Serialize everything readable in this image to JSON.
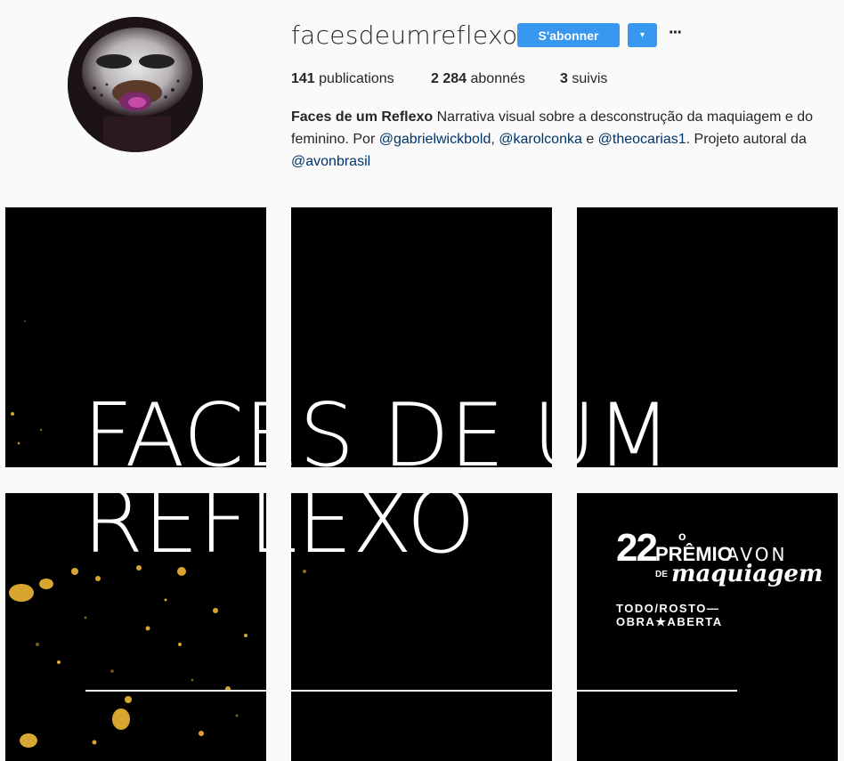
{
  "profile": {
    "username": "facesdeumreflexo",
    "follow_label": "S'abonner",
    "dropdown_glyph": "▾",
    "more_glyph": "···",
    "stats": {
      "publications_count": "141",
      "publications_label": "publications",
      "followers_count": "2 284",
      "followers_label": "abonnés",
      "following_count": "3",
      "following_label": "suivis"
    },
    "bio": {
      "name": "Faces de um Reflexo",
      "text1": " Narrativa visual sobre a desconstrução da maquiagem e do feminino. Por ",
      "mention1": "@gabrielwickbold",
      "sep1": ", ",
      "mention2": "@karolconka",
      "sep2": " e ",
      "mention3": "@theocarias1",
      "text2": ". Projeto autoral da ",
      "mention4": "@avonbrasil"
    }
  },
  "grid": {
    "title_line1": "FACES DE UM",
    "title_line2": "REFLEXO",
    "award": {
      "number": "22",
      "ordinal": "o",
      "premio": "PRÊMIO",
      "brand": "AVON",
      "de": "DE",
      "script": "maquiagem",
      "tagline": "TODO/ROSTO—OBRA★ABERTA"
    }
  },
  "colors": {
    "accent": "#3897f0",
    "link": "#003569",
    "background": "#fafafa",
    "tile": "#000000",
    "gold": "#d9a531"
  },
  "icons": [
    "avatar-photo",
    "dropdown-caret-icon",
    "more-options-icon"
  ]
}
